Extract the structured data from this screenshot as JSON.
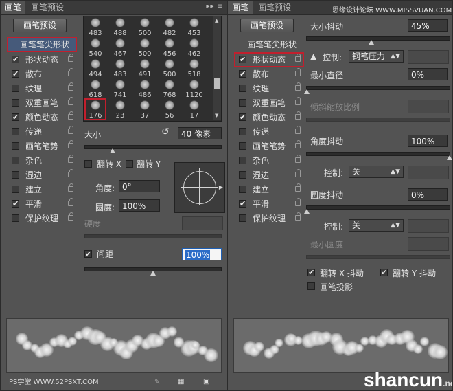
{
  "left_panel": {
    "tab_active": "画笔",
    "tab_inactive": "画笔预设",
    "panel_menu": "▸▸ |≡",
    "preset_button": "画笔预设",
    "tip_shape_label": "画笔笔尖形状",
    "sidebar": [
      {
        "label": "形状动态",
        "checked": true
      },
      {
        "label": "散布",
        "checked": true
      },
      {
        "label": "纹理",
        "checked": false
      },
      {
        "label": "双重画笔",
        "checked": false
      },
      {
        "label": "颜色动态",
        "checked": true
      },
      {
        "label": "传递",
        "checked": false
      },
      {
        "label": "画笔笔势",
        "checked": false
      },
      {
        "label": "杂色",
        "checked": false
      },
      {
        "label": "湿边",
        "checked": false
      },
      {
        "label": "建立",
        "checked": false
      },
      {
        "label": "平滑",
        "checked": true
      },
      {
        "label": "保护纹理",
        "checked": false
      }
    ],
    "brush_sizes": [
      "483",
      "488",
      "500",
      "482",
      "453",
      "540",
      "467",
      "500",
      "456",
      "462",
      "494",
      "483",
      "491",
      "500",
      "518",
      "618",
      "741",
      "486",
      "768",
      "1120",
      "176",
      "23",
      "37",
      "56",
      "17"
    ],
    "size_label": "大小",
    "size_value": "40 像素",
    "size_slider_fraction": 0.2,
    "flip_x": "翻转 X",
    "flip_y": "翻转 Y",
    "angle_label": "角度:",
    "angle_value": "0°",
    "roundness_label": "圆度:",
    "roundness_value": "100%",
    "hardness_label": "硬度",
    "spacing_label": "间距",
    "spacing_checked": true,
    "spacing_value": "100%",
    "spacing_slider_fraction": 0.5,
    "watermark": "PS学堂 WWW.52PSXT.COM"
  },
  "right_panel": {
    "tab_active": "画笔",
    "tab_inactive": "画笔预设",
    "watermark_top": "思缘设计论坛 WWW.MISSVUAN.COM",
    "preset_button": "画笔预设",
    "tip_shape_label": "画笔笔尖形状",
    "size_jitter_label": "大小抖动",
    "size_jitter_value": "45%",
    "size_jitter_fraction": 0.45,
    "control_label": "控制:",
    "control_pen": "钢笔压力",
    "min_diameter_label": "最小直径",
    "min_diameter_value": "0%",
    "tilt_scale_label": "倾斜缩放比例",
    "angle_jitter_label": "角度抖动",
    "angle_jitter_value": "100%",
    "control_off": "关",
    "roundness_jitter_label": "圆度抖动",
    "roundness_jitter_value": "0%",
    "min_roundness_label": "最小圆度",
    "flip_x_jitter": "翻转 X 抖动",
    "flip_y_jitter": "翻转 Y 抖动",
    "brush_projection": "画笔投影",
    "watermark_bottom": "shancun",
    "watermark_bottom_suffix": ".net",
    "sidebar": [
      {
        "label": "形状动态",
        "checked": true
      },
      {
        "label": "散布",
        "checked": true
      },
      {
        "label": "纹理",
        "checked": false
      },
      {
        "label": "双重画笔",
        "checked": false
      },
      {
        "label": "颜色动态",
        "checked": true
      },
      {
        "label": "传递",
        "checked": false
      },
      {
        "label": "画笔笔势",
        "checked": false
      },
      {
        "label": "杂色",
        "checked": false
      },
      {
        "label": "湿边",
        "checked": false
      },
      {
        "label": "建立",
        "checked": false
      },
      {
        "label": "平滑",
        "checked": true
      },
      {
        "label": "保护纹理",
        "checked": false
      }
    ]
  },
  "colors": {
    "panel": "#535353",
    "highlight": "#c21f2d",
    "accent_green": "#7ab53b"
  }
}
